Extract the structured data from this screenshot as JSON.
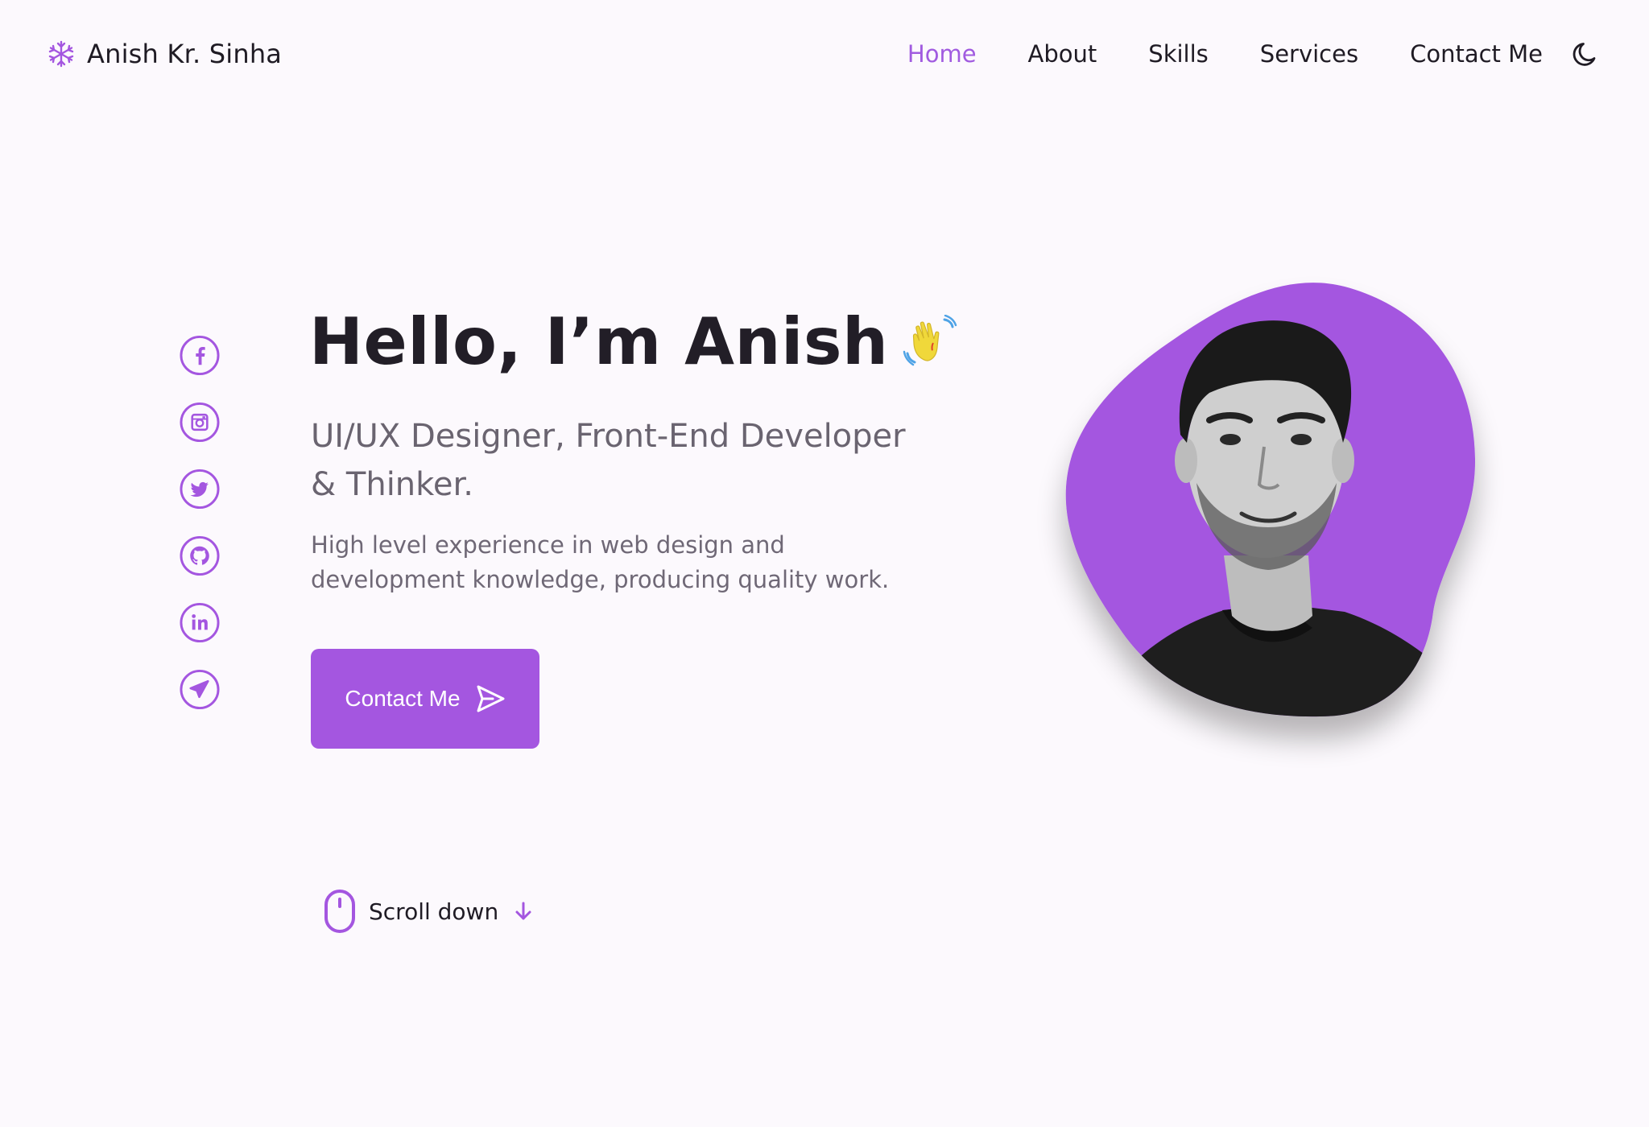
{
  "header": {
    "logo_text": "Anish Kr. Sinha",
    "logo_icon": "snowflake-icon",
    "nav": [
      {
        "label": "Home",
        "active": true
      },
      {
        "label": "About",
        "active": false
      },
      {
        "label": "Skills",
        "active": false
      },
      {
        "label": "Services",
        "active": false
      },
      {
        "label": "Contact Me",
        "active": false
      }
    ],
    "theme_toggle_icon": "moon-icon"
  },
  "social": [
    {
      "icon": "facebook-icon"
    },
    {
      "icon": "instagram-icon"
    },
    {
      "icon": "twitter-icon"
    },
    {
      "icon": "github-icon"
    },
    {
      "icon": "linkedin-icon"
    },
    {
      "icon": "telegram-icon"
    }
  ],
  "hero": {
    "title": "Hello, I’m Anish",
    "title_icon": "waving-hand-icon",
    "subtitle": "UI/UX Designer, Front-End Developer & Thinker.",
    "description": "High level experience in web design and development knowledge, producing quality work.",
    "cta_label": "Contact Me",
    "cta_icon": "send-icon"
  },
  "scroll": {
    "label": "Scroll down",
    "mouse_icon": "mouse-icon",
    "arrow_icon": "arrow-down-icon"
  },
  "portrait": {
    "image": "profile-photo"
  },
  "colors": {
    "accent": "#a456e0",
    "background": "#fcf9fd",
    "text": "#1f1b24",
    "muted": "#6a6470"
  }
}
